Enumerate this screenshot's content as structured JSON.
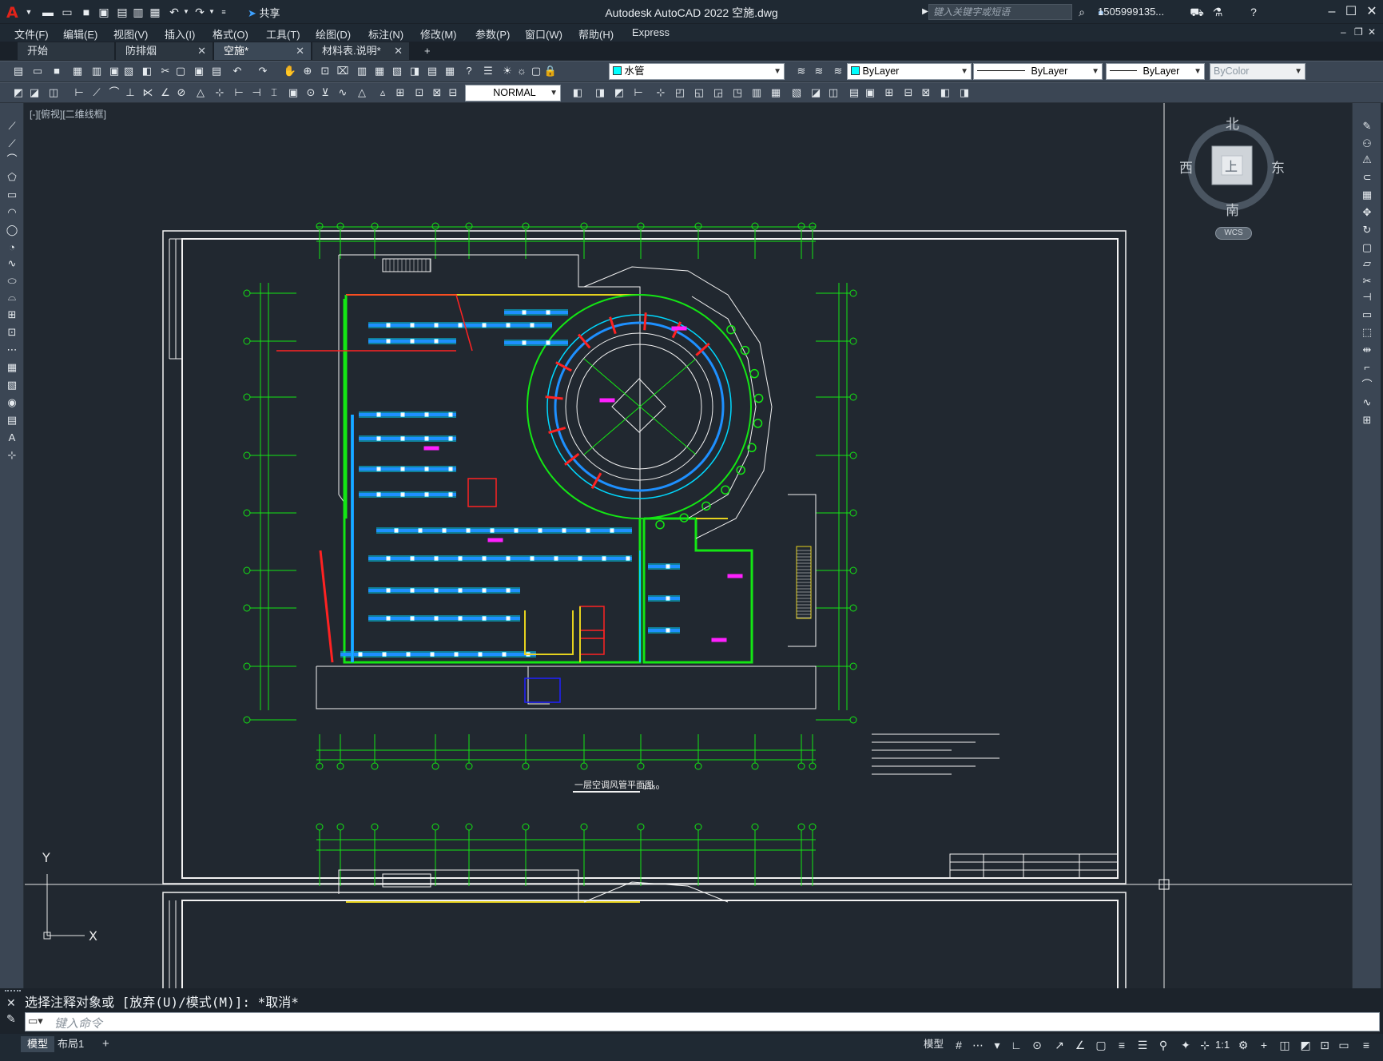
{
  "titlebar": {
    "app_icon": "A",
    "share_label": "共享",
    "title": "Autodesk AutoCAD 2022    空施.dwg",
    "search_placeholder": "键入关键字或短语",
    "user": "1505999135...",
    "icons": [
      "new-icon",
      "open-icon",
      "save-icon",
      "saveas-icon",
      "open-web-icon",
      "save-web-icon",
      "plot-icon",
      "undo-icon",
      "redo-icon",
      "share-icon",
      "search-icon",
      "user-icon",
      "cart-icon",
      "autodesk-app-icon",
      "help-icon"
    ]
  },
  "menu": [
    "文件(F)",
    "编辑(E)",
    "视图(V)",
    "插入(I)",
    "格式(O)",
    "工具(T)",
    "绘图(D)",
    "标注(N)",
    "修改(M)",
    "参数(P)",
    "窗口(W)",
    "帮助(H)",
    "Express"
  ],
  "file_tabs": [
    {
      "label": "开始",
      "closable": false,
      "active": false
    },
    {
      "label": "防排烟",
      "closable": true,
      "active": false
    },
    {
      "label": "空施*",
      "closable": true,
      "active": true
    },
    {
      "label": "材料表.说明*",
      "closable": true,
      "active": false
    }
  ],
  "toolbar": {
    "layer_name": "水管",
    "color": "ByLayer",
    "linetype": "ByLayer",
    "lineweight": "ByLayer",
    "plotstyle": "ByColor",
    "dimstyle": "NORMAL"
  },
  "viewport": {
    "label": "[-][俯视][二维线框]",
    "compass": {
      "north": "北",
      "south": "南",
      "east": "东",
      "west": "西",
      "top": "上"
    },
    "wcs": "WCS"
  },
  "drawing": {
    "title": "一层空调风管平面图",
    "scale": "1:150",
    "ucs_x": "X",
    "ucs_y": "Y"
  },
  "command": {
    "history": "选择注释对象或 [放弃(U)/模式(M)]: *取消*",
    "placeholder": "键入命令"
  },
  "layout_tabs": [
    {
      "label": "模型",
      "active": true
    },
    {
      "label": "布局1",
      "active": false
    }
  ],
  "status": {
    "model_label": "模型",
    "scale": "1:1"
  },
  "colors": {
    "background": "#212830",
    "green": "#14e614",
    "blue": "#1e90ff",
    "cyan": "#00d8ff",
    "yellow": "#e6d21e",
    "red": "#ff2222",
    "magenta": "#ff20ff",
    "white": "#f2f2f2"
  }
}
